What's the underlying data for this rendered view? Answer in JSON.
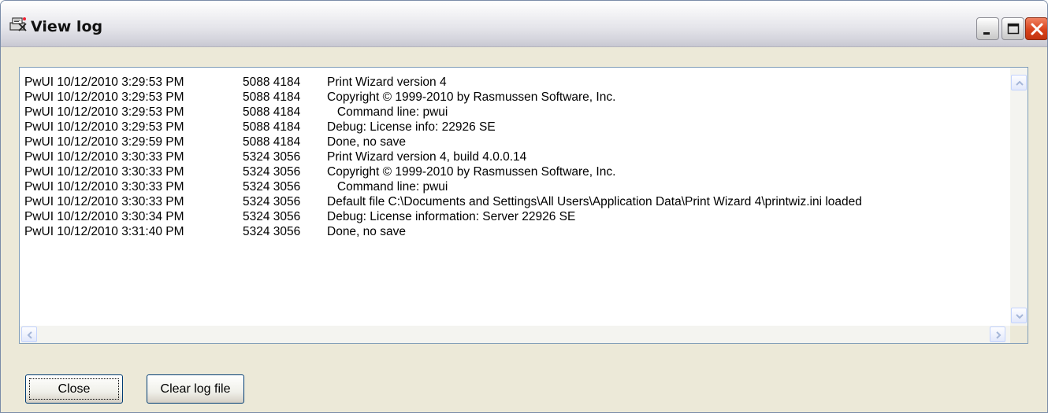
{
  "window": {
    "title": "View log",
    "icon": "printer-wizard-icon",
    "controls": [
      "minimize-icon",
      "maximize-icon",
      "close-icon"
    ]
  },
  "log": {
    "lines": [
      {
        "source": "PwUI 10/12/2010 3:29:53 PM",
        "ids": "5088 4184",
        "message": "Print Wizard version 4"
      },
      {
        "source": "PwUI 10/12/2010 3:29:53 PM",
        "ids": "5088 4184",
        "message": "Copyright © 1999-2010 by Rasmussen Software, Inc."
      },
      {
        "source": "PwUI 10/12/2010 3:29:53 PM",
        "ids": "5088 4184",
        "message": "   Command line: pwui"
      },
      {
        "source": "PwUI 10/12/2010 3:29:53 PM",
        "ids": "5088 4184",
        "message": "Debug: License info: 22926 SE"
      },
      {
        "source": "PwUI 10/12/2010 3:29:59 PM",
        "ids": "5088 4184",
        "message": "Done, no save"
      },
      {
        "source": "PwUI 10/12/2010 3:30:33 PM",
        "ids": "5324 3056",
        "message": "Print Wizard version 4, build 4.0.0.14"
      },
      {
        "source": "PwUI 10/12/2010 3:30:33 PM",
        "ids": "5324 3056",
        "message": "Copyright © 1999-2010 by Rasmussen Software, Inc."
      },
      {
        "source": "PwUI 10/12/2010 3:30:33 PM",
        "ids": "5324 3056",
        "message": "   Command line: pwui"
      },
      {
        "source": "PwUI 10/12/2010 3:30:33 PM",
        "ids": "5324 3056",
        "message": "Default file C:\\Documents and Settings\\All Users\\Application Data\\Print Wizard 4\\printwiz.ini loaded"
      },
      {
        "source": "PwUI 10/12/2010 3:30:34 PM",
        "ids": "5324 3056",
        "message": "Debug: License information: Server 22926 SE"
      },
      {
        "source": "PwUI 10/12/2010 3:31:40 PM",
        "ids": "5324 3056",
        "message": "Done, no save"
      }
    ]
  },
  "buttons": {
    "close_label": "Close",
    "clear_label": "Clear log file"
  }
}
